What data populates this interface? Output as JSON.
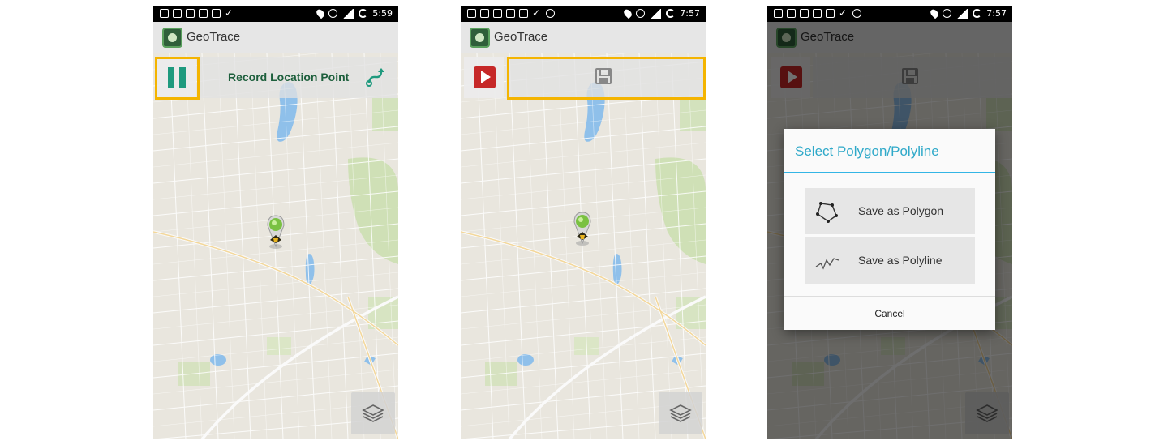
{
  "app": {
    "title": "GeoTrace"
  },
  "screens": [
    {
      "status_time": "5:59",
      "toolbar": {
        "record_label": "Record Location Point"
      }
    },
    {
      "status_time": "7:57"
    },
    {
      "status_time": "7:57",
      "dialog": {
        "title": "Select Polygon/Polyline",
        "options": [
          "Save as Polygon",
          "Save as Polyline"
        ],
        "cancel_label": "Cancel"
      }
    }
  ],
  "colors": {
    "highlight": "#f4b400",
    "pause_teal": "#1f9a7e",
    "record_green": "#1d5f3c",
    "play_red": "#c62828",
    "dialog_accent": "#33b5e5"
  },
  "icons": {
    "record_button_screen1": "pause-icon",
    "record_button_screen2": "play-icon",
    "toolbar_action_screen1": "route-icon",
    "toolbar_action_screen2": "save-icon",
    "layers": "layers-icon",
    "polygon_option": "polygon-icon",
    "polyline_option": "polyline-icon"
  }
}
